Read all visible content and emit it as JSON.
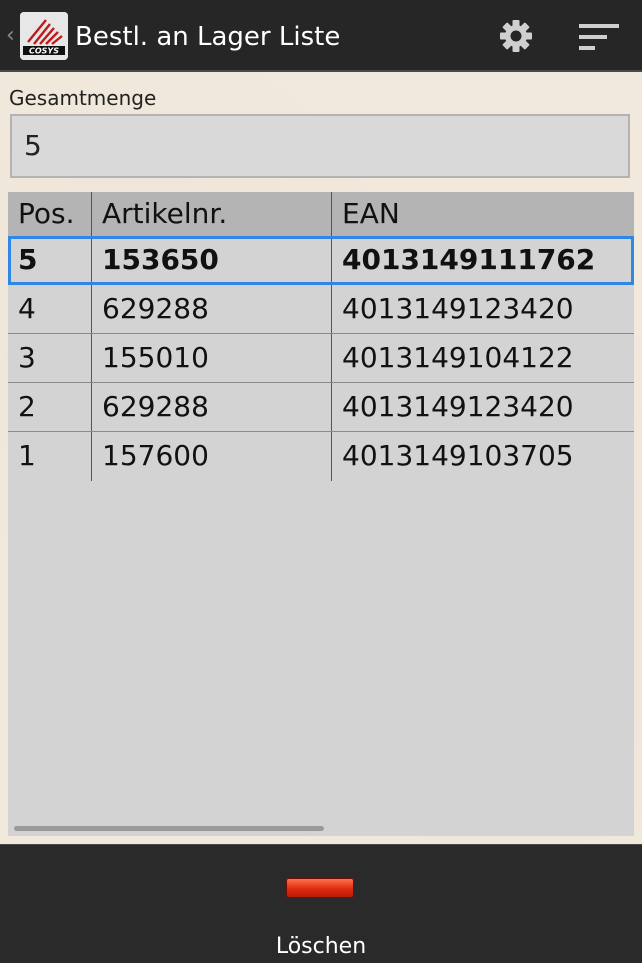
{
  "actionbar": {
    "title": "Bestl. an Lager Liste",
    "logo_text": "COSYS",
    "icons": {
      "up": "chevron-left-icon",
      "settings": "gear-icon",
      "overflow": "sort-menu-icon"
    }
  },
  "form": {
    "total_label": "Gesamtmenge",
    "total_value": "5"
  },
  "table": {
    "columns": [
      "Pos.",
      "Artikelnr.",
      "EAN"
    ],
    "rows": [
      {
        "pos": "5",
        "artikelnr": "153650",
        "ean": "4013149111762",
        "selected": true
      },
      {
        "pos": "4",
        "artikelnr": "629288",
        "ean": "4013149123420"
      },
      {
        "pos": "3",
        "artikelnr": "155010",
        "ean": "4013149104122"
      },
      {
        "pos": "2",
        "artikelnr": "629288",
        "ean": "4013149123420"
      },
      {
        "pos": "1",
        "artikelnr": "157600",
        "ean": "4013149103705"
      }
    ]
  },
  "bottombar": {
    "delete_label": "Löschen"
  },
  "colors": {
    "actionbar": "#262626",
    "background": "#f1e9dc",
    "grid": "#d3d3d3",
    "header": "#b4b4b4",
    "selection": "#2e86e6",
    "delete": "#e02a10"
  }
}
